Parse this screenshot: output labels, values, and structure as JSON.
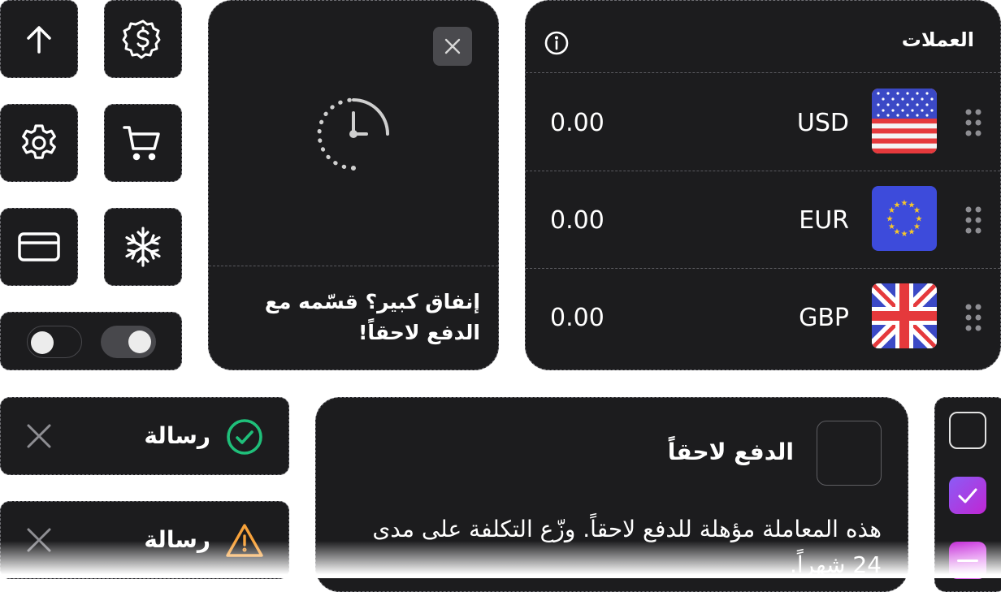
{
  "currencies": {
    "title": "العملات",
    "icons": {
      "info": "info-icon",
      "drag": "grip-icon"
    },
    "rows": [
      {
        "code": "USD",
        "amount": "0.00",
        "flag": "us-flag-icon"
      },
      {
        "code": "EUR",
        "amount": "0.00",
        "flag": "eu-flag-icon"
      },
      {
        "code": "GBP",
        "amount": "0.00",
        "flag": "uk-flag-icon"
      }
    ]
  },
  "bnpl_card": {
    "text": "إنفاق كبير؟ قسّمه مع الدفع لاحقاً!",
    "icons": {
      "close": "close-icon",
      "main": "clock-partial-icon"
    }
  },
  "icon_tiles": [
    "arrow-up-icon",
    "dollar-badge-icon",
    "settings-icon",
    "cart-icon",
    "card-icon",
    "snowflake-icon"
  ],
  "toggles": [
    {
      "state": "off"
    },
    {
      "state": "on"
    }
  ],
  "toasts": [
    {
      "text": "رسالة",
      "status": "success",
      "icon": "check-circle-icon",
      "color": "#1fbf7a"
    },
    {
      "text": "رسالة",
      "status": "warning",
      "icon": "warning-icon",
      "color": "#f7a23b"
    }
  ],
  "pay_later": {
    "label": "الدفع لاحقاً",
    "description": "هذه المعاملة مؤهلة للدفع لاحقاً. وزّع التكلفة على مدى 24 شهراً."
  },
  "checkbox_column": [
    {
      "state": "unchecked"
    },
    {
      "state": "checked",
      "color": "#a142f4"
    },
    {
      "state": "indeterminate",
      "color": "#d946c4"
    }
  ]
}
